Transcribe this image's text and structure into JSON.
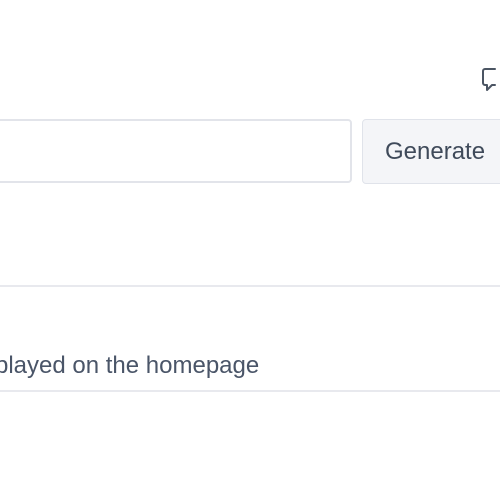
{
  "toolbar": {
    "feedback_icon": "speech-bubble-icon"
  },
  "form": {
    "input_value": "",
    "generate_label": "Generate",
    "help_text": "played on the homepage"
  },
  "colors": {
    "border": "#e2e4ea",
    "button_bg": "#f4f5f8",
    "text": "#4a5568"
  }
}
